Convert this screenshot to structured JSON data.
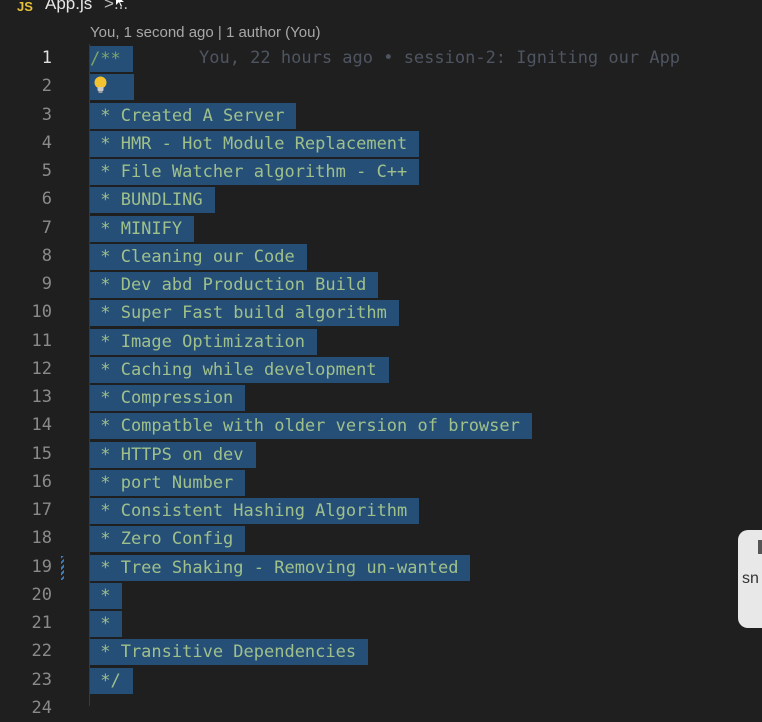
{
  "breadcrumb": {
    "lang_badge": "JS",
    "filename": "App.js",
    "chevron": ">",
    "ellipsis": "..."
  },
  "codelens": "You, 1 second ago | 1 author (You)",
  "blame": "You, 22 hours ago • session-2: Igniting our App",
  "lines": [
    {
      "num": "1",
      "text": "/**"
    },
    {
      "num": "2",
      "text": ""
    },
    {
      "num": "3",
      "text": " * Created A Server"
    },
    {
      "num": "4",
      "text": " * HMR - Hot Module Replacement"
    },
    {
      "num": "5",
      "text": " * File Watcher algorithm - C++"
    },
    {
      "num": "6",
      "text": " * BUNDLING"
    },
    {
      "num": "7",
      "text": " * MINIFY"
    },
    {
      "num": "8",
      "text": " * Cleaning our Code"
    },
    {
      "num": "9",
      "text": " * Dev abd Production Build"
    },
    {
      "num": "10",
      "text": " * Super Fast build algorithm"
    },
    {
      "num": "11",
      "text": " * Image Optimization"
    },
    {
      "num": "12",
      "text": " * Caching while development"
    },
    {
      "num": "13",
      "text": " * Compression"
    },
    {
      "num": "14",
      "text": " * Compatble with older version of browser"
    },
    {
      "num": "15",
      "text": " * HTTPS on dev"
    },
    {
      "num": "16",
      "text": " * port Number"
    },
    {
      "num": "17",
      "text": " * Consistent Hashing Algorithm"
    },
    {
      "num": "18",
      "text": " * Zero Config"
    },
    {
      "num": "19",
      "text": " * Tree Shaking - Removing un-wanted"
    },
    {
      "num": "20",
      "text": " *"
    },
    {
      "num": "21",
      "text": " *"
    },
    {
      "num": "22",
      "text": " * Transitive Dependencies"
    },
    {
      "num": "23",
      "text": " */"
    },
    {
      "num": "24",
      "text": ""
    }
  ],
  "tooltip_text": "sn",
  "colors": {
    "selection": "#264f78",
    "editor_bg": "#1f1f1f",
    "js_badge": "#e5c03a"
  },
  "icons": [
    "lightbulb-icon",
    "cursor-icon"
  ]
}
